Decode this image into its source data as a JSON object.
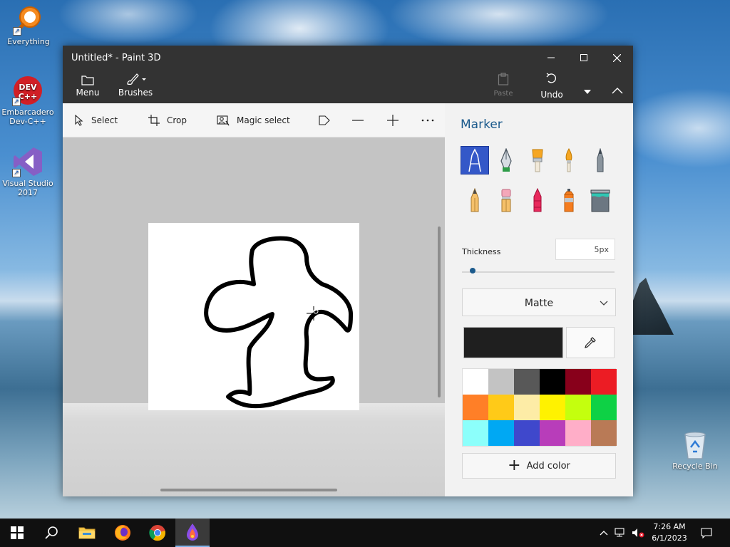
{
  "desktop": {
    "icons": [
      {
        "label": "Everything"
      },
      {
        "label": "Embarcadero Dev-C++"
      },
      {
        "label": "Visual Studio 2017"
      },
      {
        "label": "Recycle Bin"
      }
    ]
  },
  "window": {
    "title": "Untitled* - Paint 3D",
    "ribbon": {
      "menu_label": "Menu",
      "brushes_label": "Brushes",
      "paste_label": "Paste",
      "undo_label": "Undo"
    },
    "toolbar": {
      "select_label": "Select",
      "crop_label": "Crop",
      "magic_select_label": "Magic select"
    },
    "panel": {
      "title": "Marker",
      "brushes": [
        "marker",
        "calligraphy-pen",
        "oil-brush",
        "watercolor",
        "pixel-pen",
        "pencil",
        "eraser",
        "crayon",
        "spray-can",
        "fill"
      ],
      "thickness_label": "Thickness",
      "thickness_value": "5px",
      "thickness_fraction": 0.05,
      "finish_value": "Matte",
      "current_color": "#1f1f1f",
      "palette": [
        "#ffffff",
        "#c3c3c3",
        "#585858",
        "#000000",
        "#88001b",
        "#ec1c24",
        "#ff7f27",
        "#ffca18",
        "#fdeca6",
        "#fff200",
        "#c4ff0e",
        "#0ed145",
        "#8cfffb",
        "#00a8f3",
        "#3f48cc",
        "#b83dba",
        "#ffaec8",
        "#b97a56"
      ],
      "add_color_label": "Add color"
    }
  },
  "taskbar": {
    "apps": [
      "windows-start",
      "search",
      "file-explorer",
      "firefox",
      "chrome",
      "paint-3d"
    ],
    "clock_time": "7:26 AM",
    "clock_date": "6/1/2023"
  },
  "colors": {
    "titlebar": "#333333",
    "accent": "#1b5a8c",
    "selected_brush": "#3458c8"
  }
}
